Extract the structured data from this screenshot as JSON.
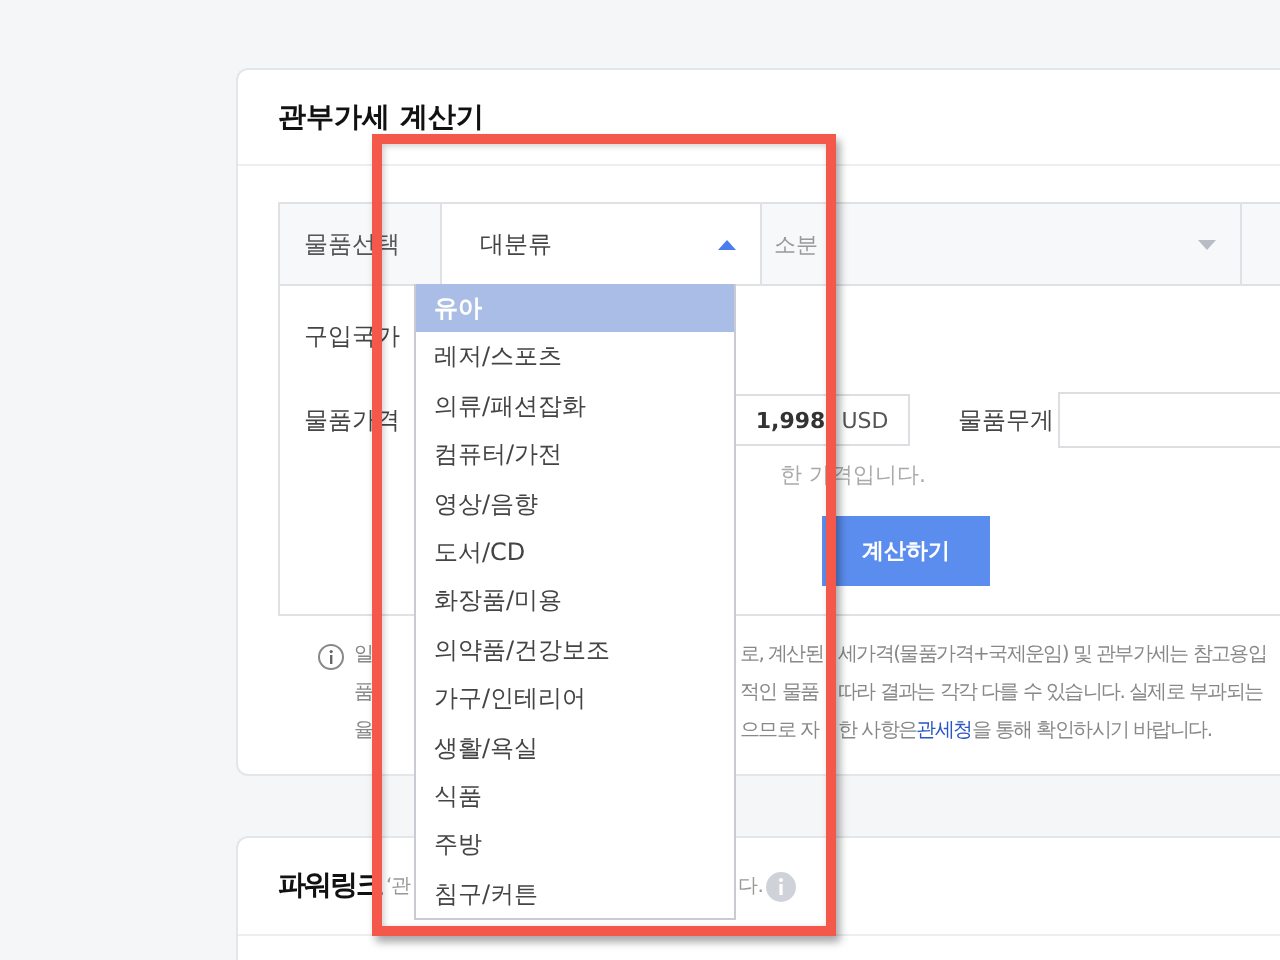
{
  "calculator": {
    "title": "관부가세 계산기",
    "steps": [
      {
        "label": "물품선택",
        "kind": "label"
      },
      {
        "label": "대분류",
        "kind": "select",
        "expanded": true
      },
      {
        "label": "소분",
        "kind": "select",
        "expanded": false
      }
    ],
    "dropdown": [
      {
        "label": "유아",
        "selected": true
      },
      {
        "label": "레저/스포츠",
        "selected": false
      },
      {
        "label": "의류/패션잡화",
        "selected": false
      },
      {
        "label": "컴퓨터/가전",
        "selected": false
      },
      {
        "label": "영상/음향",
        "selected": false
      },
      {
        "label": "도서/CD",
        "selected": false
      },
      {
        "label": "화장품/미용",
        "selected": false
      },
      {
        "label": "의약품/건강보조",
        "selected": false
      },
      {
        "label": "가구/인테리어",
        "selected": false
      },
      {
        "label": "생활/욕실",
        "selected": false
      },
      {
        "label": "식품",
        "selected": false
      },
      {
        "label": "주방",
        "selected": false
      },
      {
        "label": "침구/커튼",
        "selected": false
      }
    ],
    "form": {
      "country_label": "구입국가",
      "price_label": "물품가격",
      "price_value": "1,998",
      "currency": "USD",
      "weight_label": "물품무게",
      "price_note": "한 가격입니다.",
      "calculate_button": "계산하기"
    },
    "notice": [
      {
        "left": "일",
        "mid": "로, 계산된",
        "right": "세가격(물품가격+국제운임) 및 관부가세는 참고용입"
      },
      {
        "left": "품",
        "mid": "적인 물품",
        "right": "따라 결과는 각각 다를 수 있습니다. 실제로 부과되는"
      },
      {
        "left": "율",
        "mid": "으므로 자",
        "right": "한 사항은",
        "link": "관세청",
        "tail": "을 통해 확인하시기 바랍니다."
      }
    ]
  },
  "powerlink": {
    "title": "파워링크",
    "subtitle_start": "‘관",
    "subtitle_end": "다."
  }
}
